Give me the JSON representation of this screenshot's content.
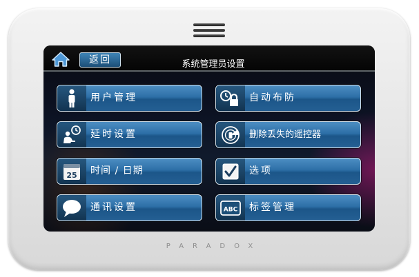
{
  "header": {
    "back_label": "返回",
    "title": "系统管理员设置"
  },
  "menu": {
    "items": [
      {
        "label": "用户管理",
        "icon": "user-icon"
      },
      {
        "label": "自动布防",
        "icon": "auto-arm-clock-lock-icon"
      },
      {
        "label": "延时设置",
        "icon": "delay-user-clock-icon"
      },
      {
        "label": "删除丢失的遥控器",
        "icon": "remote-radar-icon"
      },
      {
        "label": "时间 / 日期",
        "icon": "calendar-icon",
        "calendar_day": "25"
      },
      {
        "label": "选项",
        "icon": "checkbox-icon"
      },
      {
        "label": "通讯设置",
        "icon": "speech-bubble-icon"
      },
      {
        "label": "标签管理",
        "icon": "abc-label-icon",
        "icon_text": "ABC"
      }
    ]
  },
  "brand": {
    "name": "PARADOX"
  },
  "colors": {
    "accent": "#2d6fa7",
    "icon_bg": "#123451",
    "screen_bg": "#0b1020"
  }
}
